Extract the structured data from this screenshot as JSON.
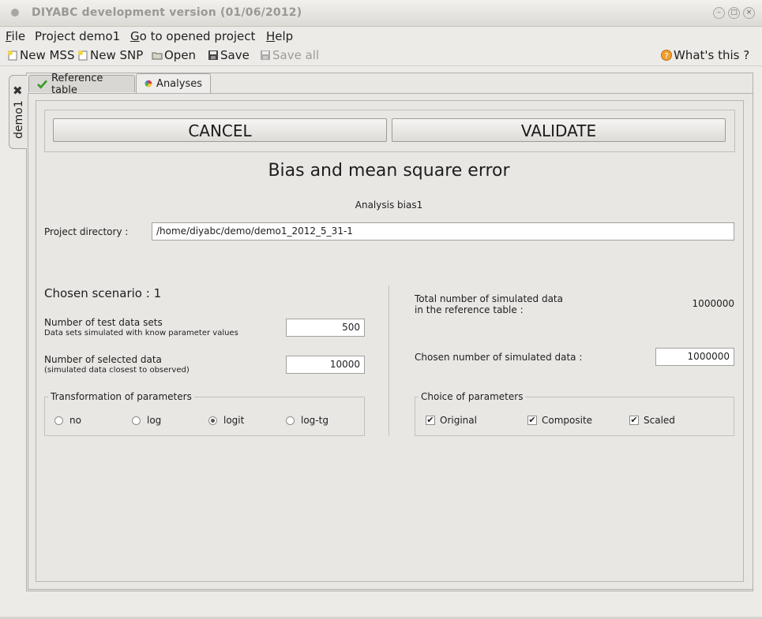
{
  "window": {
    "title": "DIYABC development version  (01/06/2012)"
  },
  "menubar": {
    "items": [
      {
        "label": "File",
        "mn": "F",
        "rest": "ile"
      },
      {
        "label": "Project demo1",
        "mn": "",
        "rest": "Project demo1"
      },
      {
        "label": "Go to opened project",
        "mn": "G",
        "rest": "o to opened project"
      },
      {
        "label": "Help",
        "mn": "H",
        "rest": "elp"
      }
    ]
  },
  "toolbar": {
    "new_mss": "New MSS",
    "new_snp": "New SNP",
    "open": "Open",
    "save": "Save",
    "save_all": "Save all",
    "whats_this": "What's this ?"
  },
  "project_tab": {
    "label": "demo1"
  },
  "tabs": {
    "reference_table": "Reference table",
    "analyses": "Analyses"
  },
  "buttons": {
    "cancel": "CANCEL",
    "validate": "VALIDATE"
  },
  "analysis": {
    "heading": "Bias and mean square error",
    "name": "Analysis bias1",
    "project_dir_label": "Project directory :",
    "project_dir_value": "/home/diyabc/demo/demo1_2012_5_31-1",
    "chosen_scenario": "Chosen scenario : 1",
    "test_sets_label": "Number of test data sets",
    "test_sets_sub": "Data sets simulated with know parameter values",
    "test_sets_value": "500",
    "selected_label": "Number of selected data",
    "selected_sub": "(simulated data closest to observed)",
    "selected_value": "10000",
    "total_sim_label_1": "Total number of simulated data",
    "total_sim_label_2": "in the reference table :",
    "total_sim_value": "1000000",
    "chosen_sim_label": "Chosen number of simulated data :",
    "chosen_sim_value": "1000000"
  },
  "transformation": {
    "title": "Transformation of parameters",
    "options": [
      "no",
      "log",
      "logit",
      "log-tg"
    ],
    "selected": "logit"
  },
  "choice": {
    "title": "Choice of parameters",
    "options": [
      {
        "label": "Original",
        "checked": true
      },
      {
        "label": "Composite",
        "checked": true
      },
      {
        "label": "Scaled",
        "checked": true
      }
    ]
  },
  "colors": {
    "window_bg": "#ecebe8",
    "check_green": "#3e9d2a",
    "help_orange": "#f0a030"
  }
}
